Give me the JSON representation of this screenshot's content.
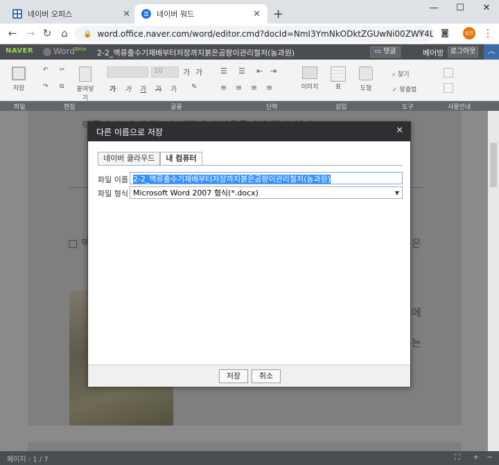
{
  "browser": {
    "tabs": [
      {
        "title": "네이버 오피스",
        "active": false
      },
      {
        "title": "네이버 워드",
        "active": true
      }
    ],
    "url": "word.office.naver.com/word/editor.cmd?docId=NmI3YmNkODktZGUwNi00ZWY4LTkxNT...",
    "profile_label": "승인"
  },
  "app": {
    "logo": "NAVER",
    "product": "Word",
    "product_tag": "Beta",
    "doc_title": "2-2_맥류출수기재배부터저장까지붉은곰팡이관리철저(농과원)",
    "comments_label": "댓글",
    "user_name": "베어방",
    "logout_label": "로그아웃"
  },
  "ribbon": {
    "save_label": "저장",
    "paste_label": "붙여넣기",
    "font_size": "10",
    "format_glyphs": [
      "가",
      "가",
      "가",
      "가",
      "가"
    ],
    "image_label": "이미지",
    "table_label": "표",
    "shape_label": "도형",
    "find_label": "찾기",
    "spell_label": "맞춤법",
    "groups": [
      "파일",
      "편집",
      "글꼴",
      "단락",
      "삽입",
      "도구",
      "사용안내"
    ]
  },
  "document": {
    "bg_line1": "맥류 출수기 재배부터 저장까지 붉은곰팡이 관리 철저",
    "bg_checkbox_fragment": "□ 맥",
    "bg_fragment_right1": "은",
    "bg_fragment_right2": "에",
    "bg_fragment_right3": "는",
    "page_indicator": "페이지 : 1 / 7"
  },
  "dialog": {
    "title": "다른 이름으로 저장",
    "tabs": [
      "네이버 클라우드",
      "내 컴퓨터"
    ],
    "selected_tab": "내 컴퓨터",
    "file_name_label": "파일 이름",
    "file_name_value": "2-2_맥류출수기재배부터저장까지붉은곰팡이관리철저(농과원)",
    "file_type_label": "파일 형식",
    "file_type_value": "Microsoft Word 2007 형식(*.docx)",
    "save_button": "저장",
    "cancel_button": "취소"
  }
}
